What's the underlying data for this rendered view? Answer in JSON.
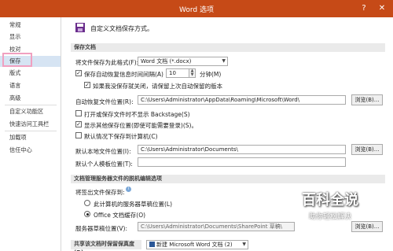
{
  "window": {
    "title": "Word 选项",
    "help": "?",
    "close": "✕"
  },
  "sidebar": {
    "items": [
      "常规",
      "显示",
      "校对",
      "保存",
      "版式",
      "语言",
      "高级",
      "自定义功能区",
      "快速访问工具栏",
      "加载项",
      "信任中心"
    ],
    "active_index": 3
  },
  "header": {
    "text": "自定义文档保存方式。"
  },
  "save_docs": {
    "section_title": "保存文档",
    "format_label": "将文件保存为此格式(F):",
    "format_value": "Word 文档 (*.docx)",
    "autorecover_label": "保存自动恢复信息时间间隔(A)",
    "autorecover_minutes": "10",
    "minutes_label": "分钟(M)",
    "keep_last_label": "如果我没保存就关闭，请保留上次自动保留的版本",
    "autorecover_path_label": "自动恢复文件位置(R):",
    "autorecover_path": "C:\\Users\\Administrator\\AppData\\Roaming\\Microsoft\\Word\\",
    "browse": "浏览(B)...",
    "no_backstage_label": "打开或保存文件时不显示 Backstage(S)",
    "show_other_label": "显示其他保存位置(即使可能需要登录)(S)。",
    "default_computer_label": "默认情况下保存到计算机(C)",
    "default_local_label": "默认本地文件位置(I):",
    "default_local_path": "C:\\Users\\Administrator\\Documents\\",
    "browse2": "浏览(B)...",
    "personal_template_label": "默认个人模板位置(T):",
    "personal_template_path": ""
  },
  "offline": {
    "section_title": "文档管理服务器文件的脱机编辑选项",
    "save_checked_label": "将签出文件保存到:",
    "radio1": "此计算机的服务器草稿位置(L)",
    "radio2": "Office 文档缓存(O)",
    "drafts_label": "服务器草稿位置(V):",
    "drafts_path": "C:\\Users\\Administrator\\Documents\\SharePoint 草稿\\",
    "browse3": "浏览(B)..."
  },
  "fidelity": {
    "section_title": "共享该文档时保留保真度(D):",
    "doc_value": "新建 Microsoft Word 文档 (2)"
  },
  "watermark": {
    "logo": "百科全说",
    "sub": "助你轻松解决"
  },
  "colors": {
    "titlebar": "#c64a17",
    "active": "#d6e4f3",
    "highlight": "#f0a0c0"
  }
}
